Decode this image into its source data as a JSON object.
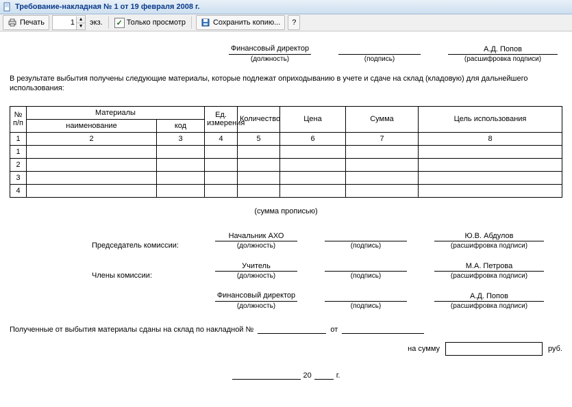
{
  "window": {
    "title": "Требование-накладная № 1 от 19 февраля 2008 г."
  },
  "toolbar": {
    "print": "Печать",
    "copies_value": "1",
    "copies_label": "экз.",
    "view_only": "Только просмотр",
    "view_only_checked": "✓",
    "save_copy": "Сохранить копию...",
    "help": "?"
  },
  "top_sig": {
    "position_value": "Финансовый директор",
    "position_caption": "(должность)",
    "sign_caption": "(подпись)",
    "name_value": "А.Д. Попов",
    "name_caption": "(расшифровка подписи)"
  },
  "paragraph": "В результате выбытия получены следующие материалы, которые подлежат оприходыванию в учете и сдаче на склад (кладовую) для дальнейшего использования:",
  "table": {
    "headers": {
      "npp": "№ п/п",
      "materials": "Материалы",
      "mat_name": "наименование",
      "mat_code": "код",
      "unit": "Ед. измерения",
      "qty": "Количество",
      "price": "Цена",
      "sum": "Сумма",
      "purpose": "Цель использования"
    },
    "nums": {
      "c1": "1",
      "c2": "2",
      "c3": "3",
      "c4": "4",
      "c5": "5",
      "c6": "6",
      "c7": "7",
      "c8": "8"
    },
    "rows": [
      "1",
      "2",
      "3",
      "4"
    ]
  },
  "amount_words_caption": "(сумма прописью)",
  "commission": {
    "chairman_label": "Председатель комиссии:",
    "members_label": "Члены комиссии:",
    "rows": [
      {
        "pos": "Начальник АХО",
        "name": "Ю.В. Абдулов"
      },
      {
        "pos": "Учитель",
        "name": "М.А. Петрова"
      },
      {
        "pos": "Финансовый директор",
        "name": "А.Д. Попов"
      }
    ],
    "pos_caption": "(должность)",
    "sign_caption": "(подпись)",
    "name_caption": "(расшифровка подписи)"
  },
  "handover": {
    "text": "Полученные от выбытия материалы сданы на склад по накладной №",
    "from": "от"
  },
  "total": {
    "label": "на сумму",
    "unit": "руб."
  },
  "date": {
    "year_prefix": "20",
    "year_suffix": "г."
  }
}
